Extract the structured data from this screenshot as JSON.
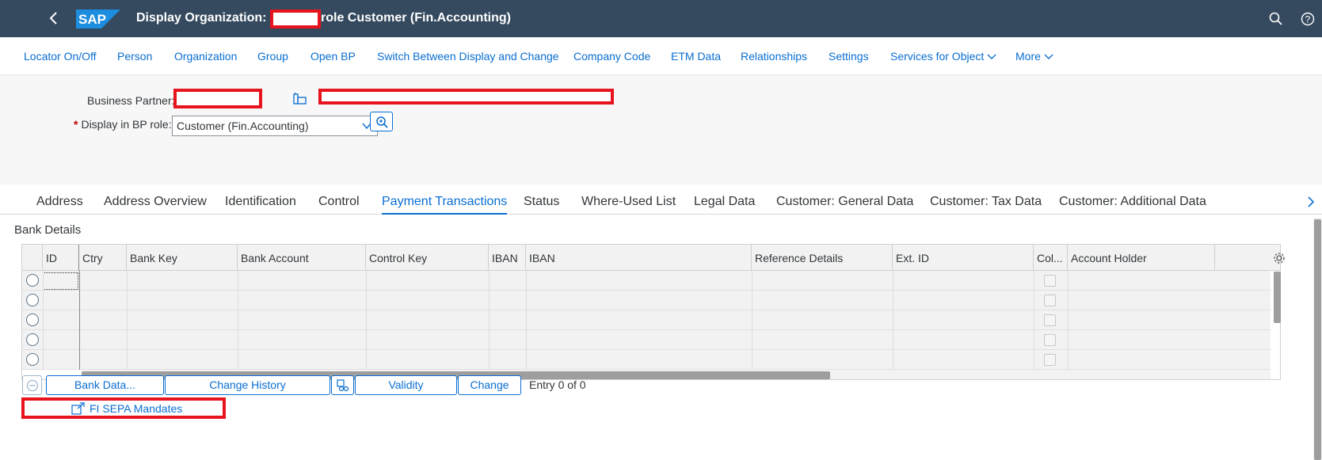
{
  "shell": {
    "title": "Display Organization:",
    "title_suffix": "role Customer (Fin.Accounting)",
    "logo_text": "SAP"
  },
  "menu": [
    "Locator On/Off",
    "Person",
    "Organization",
    "Group",
    "Open BP",
    "Switch Between Display and Change",
    "Company Code",
    "ETM Data",
    "Relationships",
    "Settings",
    "Services for Object",
    "More"
  ],
  "header": {
    "bp_label": "Business Partner:",
    "role_label": "Display in BP role:",
    "role_value": "Customer (Fin.Accounting)"
  },
  "tabs": [
    "Address",
    "Address Overview",
    "Identification",
    "Control",
    "Payment Transactions",
    "Status",
    "Where-Used List",
    "Legal Data",
    "Customer: General Data",
    "Customer: Tax Data",
    "Customer: Additional Data"
  ],
  "active_tab": "Payment Transactions",
  "bank_details": {
    "title": "Bank Details",
    "columns": [
      "ID",
      "Ctry",
      "Bank Key",
      "Bank Account",
      "Control Key",
      "IBAN",
      "IBAN",
      "Reference Details",
      "Ext. ID",
      "Col...",
      "Account Holder"
    ],
    "row_count": 5
  },
  "actions": {
    "bank_data": "Bank Data...",
    "change_history": "Change History",
    "validity": "Validity",
    "change": "Change",
    "entry": "Entry 0 of 0",
    "sepa": "FI SEPA Mandates"
  }
}
